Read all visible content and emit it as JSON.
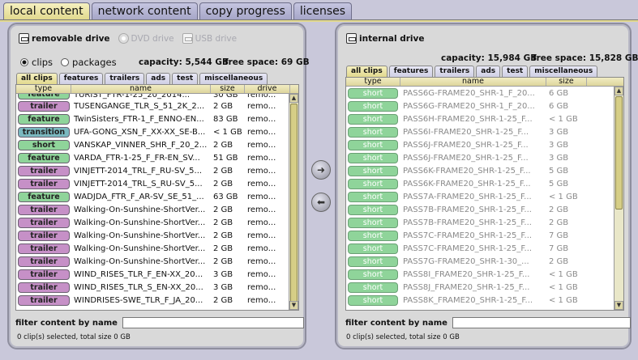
{
  "top_tabs": [
    "local content",
    "network content",
    "copy progress",
    "licenses"
  ],
  "left": {
    "sources": [
      {
        "label": "removable drive",
        "state": "active",
        "icon": "drive-icon"
      },
      {
        "label": "DVD drive",
        "state": "disabled",
        "icon": "disc-icon"
      },
      {
        "label": "USB drive",
        "state": "disabled",
        "icon": "usb-icon"
      }
    ],
    "radio_clips": "clips",
    "radio_packages": "packages",
    "capacity": "capacity: 5,544 GB",
    "free_space": "free space: 69 GB",
    "tabs": [
      "all clips",
      "features",
      "trailers",
      "ads",
      "test",
      "miscellaneous"
    ],
    "columns": [
      "type",
      "name",
      "size",
      "drive"
    ],
    "rows": [
      {
        "type": "feature",
        "name": "TURIST_FTR-1-25_20_2014...",
        "size": "30 GB",
        "drive": "remo..."
      },
      {
        "type": "trailer",
        "name": "TUSENGANGE_TLR_S_51_2K_2...",
        "size": "2 GB",
        "drive": "remo..."
      },
      {
        "type": "feature",
        "name": "TwinSisters_FTR-1_F_ENNO-EN...",
        "size": "83 GB",
        "drive": "remo..."
      },
      {
        "type": "transition",
        "name": "UFA-GONG_XSN_F_XX-XX_SE-B...",
        "size": "< 1 GB",
        "drive": "remo..."
      },
      {
        "type": "short",
        "name": "VANSKAP_VINNER_SHR_F_20_2...",
        "size": "2 GB",
        "drive": "remo..."
      },
      {
        "type": "feature",
        "name": "VARDA_FTR-1-25_F_FR-EN_SV...",
        "size": "51 GB",
        "drive": "remo..."
      },
      {
        "type": "trailer",
        "name": "VINJETT-2014_TRL_F_RU-SV_5...",
        "size": "2 GB",
        "drive": "remo..."
      },
      {
        "type": "trailer",
        "name": "VINJETT-2014_TRL_S_RU-SV_5...",
        "size": "2 GB",
        "drive": "remo..."
      },
      {
        "type": "feature",
        "name": "WADJDA_FTR_F_AR-SV_SE_51_...",
        "size": "63 GB",
        "drive": "remo..."
      },
      {
        "type": "trailer",
        "name": "Walking-On-Sunshine-ShortVer...",
        "size": "2 GB",
        "drive": "remo..."
      },
      {
        "type": "trailer",
        "name": "Walking-On-Sunshine-ShortVer...",
        "size": "2 GB",
        "drive": "remo..."
      },
      {
        "type": "trailer",
        "name": "Walking-On-Sunshine-ShortVer...",
        "size": "2 GB",
        "drive": "remo..."
      },
      {
        "type": "trailer",
        "name": "Walking-On-Sunshine-ShortVer...",
        "size": "2 GB",
        "drive": "remo..."
      },
      {
        "type": "trailer",
        "name": "Walking-On-Sunshine-ShortVer...",
        "size": "2 GB",
        "drive": "remo..."
      },
      {
        "type": "trailer",
        "name": "WIND_RISES_TLR_F_EN-XX_20...",
        "size": "3 GB",
        "drive": "remo..."
      },
      {
        "type": "trailer",
        "name": "WIND_RISES_TLR_S_EN-XX_20...",
        "size": "3 GB",
        "drive": "remo..."
      },
      {
        "type": "trailer",
        "name": "WINDRISES-SWE_TLR_F_JA_20...",
        "size": "2 GB",
        "drive": "remo..."
      }
    ],
    "filter_label": "filter content by name",
    "filter_value": "",
    "status": "0 clip(s) selected, total size 0 GB"
  },
  "right": {
    "source": {
      "label": "internal drive",
      "icon": "drive-icon"
    },
    "capacity": "capacity: 15,984 GB",
    "free_space": "free space: 15,828 GB",
    "tabs": [
      "all clips",
      "features",
      "trailers",
      "ads",
      "test",
      "miscellaneous"
    ],
    "columns": [
      "type",
      "name",
      "size"
    ],
    "rows": [
      {
        "type": "short",
        "name": "PASS6G-FRAME20_SHR-1_F_20...",
        "size": "6 GB"
      },
      {
        "type": "short",
        "name": "PASS6G-FRAME20_SHR-1_F_20...",
        "size": "6 GB"
      },
      {
        "type": "short",
        "name": "PASS6H-FRAME20_SHR-1-25_F...",
        "size": "< 1 GB"
      },
      {
        "type": "short",
        "name": "PASS6I-FRAME20_SHR-1-25_F...",
        "size": "3 GB"
      },
      {
        "type": "short",
        "name": "PASS6J-FRAME20_SHR-1-25_F...",
        "size": "3 GB"
      },
      {
        "type": "short",
        "name": "PASS6J-FRAME20_SHR-1-25_F...",
        "size": "3 GB"
      },
      {
        "type": "short",
        "name": "PASS6K-FRAME20_SHR-1-25_F...",
        "size": "5 GB"
      },
      {
        "type": "short",
        "name": "PASS6K-FRAME20_SHR-1-25_F...",
        "size": "5 GB"
      },
      {
        "type": "short",
        "name": "PASS7A-FRAME20_SHR-1-25_F...",
        "size": "< 1 GB"
      },
      {
        "type": "short",
        "name": "PASS7B-FRAME20_SHR-1-25_F...",
        "size": "2 GB"
      },
      {
        "type": "short",
        "name": "PASS7B-FRAME20_SHR-1-25_F...",
        "size": "2 GB"
      },
      {
        "type": "short",
        "name": "PASS7C-FRAME20_SHR-1-25_F...",
        "size": "7 GB"
      },
      {
        "type": "short",
        "name": "PASS7C-FRAME20_SHR-1-25_F...",
        "size": "7 GB"
      },
      {
        "type": "short",
        "name": "PASS7G-FRAME20_SHR-1-30_...",
        "size": "2 GB"
      },
      {
        "type": "short",
        "name": "PASS8I_FRAME20_SHR-1-25_F...",
        "size": "< 1 GB"
      },
      {
        "type": "short",
        "name": "PASS8J_FRAME20_SHR-1-25_F...",
        "size": "< 1 GB"
      },
      {
        "type": "short",
        "name": "PASS8K_FRAME20_SHR-1-25_F...",
        "size": "< 1 GB"
      }
    ],
    "filter_label": "filter content by name",
    "filter_value": "",
    "status": "0 clip(s) selected, total size 0 GB"
  },
  "transfer": {
    "copy_to_right": "➜",
    "copy_to_left": "⬅"
  }
}
